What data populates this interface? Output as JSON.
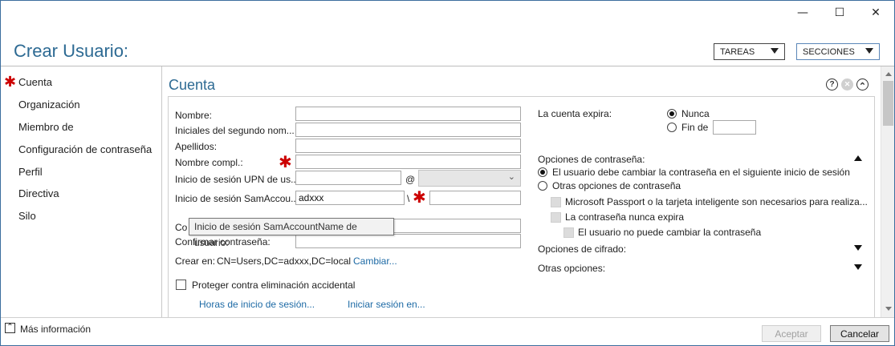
{
  "window": {
    "minimize_glyph": "—",
    "maximize_glyph": "☐",
    "close_glyph": "✕"
  },
  "header": {
    "title": "Crear Usuario:",
    "tasks_label": "TAREAS",
    "sections_label": "SECCIONES"
  },
  "nav": {
    "items": [
      {
        "label": "Cuenta",
        "required": true
      },
      {
        "label": "Organización"
      },
      {
        "label": "Miembro de"
      },
      {
        "label": "Configuración de contraseña"
      },
      {
        "label": "Perfil"
      },
      {
        "label": "Directiva"
      },
      {
        "label": "Silo"
      }
    ]
  },
  "section": {
    "title": "Cuenta",
    "help_glyph": "?",
    "close_glyph": "✕",
    "collapse_glyph": "⌃"
  },
  "form": {
    "nombre_label": "Nombre:",
    "iniciales_label": "Iniciales del segundo nom...",
    "apellidos_label": "Apellidos:",
    "nombre_compl_label": "Nombre compl.:",
    "upn_label": "Inicio de sesión UPN de us...",
    "upn_at": "@",
    "sam_label": "Inicio de sesión SamAccou...",
    "sam_value": "adxxx",
    "sam_sep": "\\",
    "contrasena_label_partial": "Co",
    "confirmar_label": "Confirmar contraseña:",
    "crear_en_label": "Crear en:",
    "crear_en_value": "CN=Users,DC=adxxx,DC=local",
    "cambiar_link": "Cambiar...",
    "proteger_label": "Proteger contra eliminación accidental",
    "horas_link": "Horas de inicio de sesión...",
    "iniciar_link": "Iniciar sesión en..."
  },
  "tooltip": "Inicio de sesión SamAccountName de usuario:",
  "right": {
    "expira_label": "La cuenta expira:",
    "nunca_label": "Nunca",
    "fin_de_label": "Fin de",
    "opciones_contrasena_label": "Opciones de contraseña:",
    "debe_cambiar_label": "El usuario debe cambiar la contraseña en el siguiente inicio de sesión",
    "otras_opciones_contrasena_label": "Otras opciones de contraseña",
    "passport_label": "Microsoft Passport o la tarjeta inteligente son necesarios para realiza...",
    "nunca_expira_label": "La contraseña nunca expira",
    "no_puede_cambiar_label": "El usuario no puede cambiar la contraseña",
    "cifrado_label": "Opciones de cifrado:",
    "otras_opciones_label": "Otras opciones:"
  },
  "footer": {
    "mas_info_label": "Más información",
    "aceptar_label": "Aceptar",
    "cancelar_label": "Cancelar"
  },
  "colors": {
    "accent": "#2d6a93",
    "link": "#1d6aa5",
    "required": "#cc0000"
  }
}
